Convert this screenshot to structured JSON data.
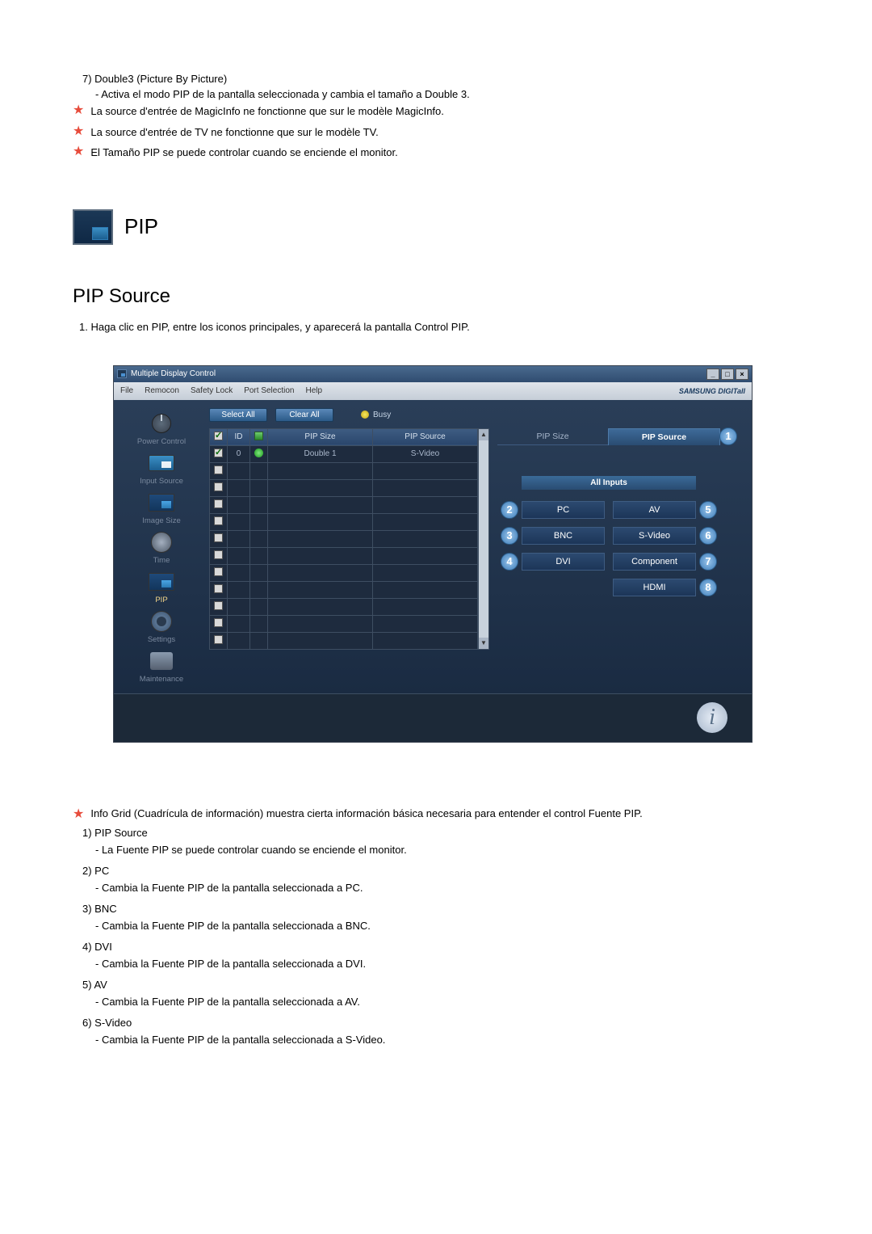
{
  "top": {
    "item7_label": "7)  Double3 (Picture By Picture)",
    "item7_desc": "- Activa el modo PIP de la pantalla seleccionada y cambia el tamaño a Double 3.",
    "star1": "La source d'entrée de MagicInfo ne fonctionne que sur le modèle MagicInfo.",
    "star2": "La source d'entrée de TV ne fonctionne que sur le modèle TV.",
    "star3": "El Tamaño PIP se puede controlar cuando se enciende el monitor."
  },
  "heading": {
    "pip": "PIP",
    "sub": "PIP Source",
    "step1": "1.  Haga clic en PIP, entre los iconos principales, y aparecerá la pantalla Control PIP."
  },
  "app": {
    "title": "Multiple Display Control",
    "menus": {
      "file": "File",
      "remocon": "Remocon",
      "safety": "Safety Lock",
      "port": "Port Selection",
      "help": "Help"
    },
    "brand": "SAMSUNG DIGITall",
    "sidebar": {
      "power": "Power Control",
      "input": "Input Source",
      "image": "Image Size",
      "time": "Time",
      "pip": "PIP",
      "settings": "Settings",
      "maintenance": "Maintenance"
    },
    "toolbar": {
      "select_all": "Select All",
      "clear_all": "Clear All",
      "busy": "Busy"
    },
    "table": {
      "headers": {
        "id": "ID",
        "pip_size": "PIP Size",
        "pip_source": "PIP Source"
      },
      "row0": {
        "id": "0",
        "size": "Double 1",
        "source": "S-Video"
      }
    },
    "right": {
      "tab_size": "PIP Size",
      "tab_source": "PIP Source",
      "all_inputs": "All Inputs",
      "pc": "PC",
      "av": "AV",
      "bnc": "BNC",
      "svideo": "S-Video",
      "dvi": "DVI",
      "component": "Component",
      "hdmi": "HDMI",
      "badges": {
        "b1": "1",
        "b2": "2",
        "b3": "3",
        "b4": "4",
        "b5": "5",
        "b6": "6",
        "b7": "7",
        "b8": "8"
      }
    }
  },
  "bottom": {
    "star_info": "Info Grid (Cuadrícula de información) muestra cierta información básica necesaria para entender el control Fuente PIP.",
    "i1": "1)  PIP Source",
    "i1d": "- La Fuente PIP se puede controlar cuando se enciende el monitor.",
    "i2": "2)  PC",
    "i2d": "- Cambia la Fuente PIP de la pantalla seleccionada a PC.",
    "i3": "3)  BNC",
    "i3d": "- Cambia la Fuente PIP de la pantalla seleccionada a BNC.",
    "i4": "4)  DVI",
    "i4d": "- Cambia la Fuente PIP de la pantalla seleccionada a DVI.",
    "i5": "5)  AV",
    "i5d": "- Cambia la Fuente PIP de la pantalla seleccionada a AV.",
    "i6": "6)  S-Video",
    "i6d": "- Cambia la Fuente PIP de la pantalla seleccionada a S-Video."
  }
}
